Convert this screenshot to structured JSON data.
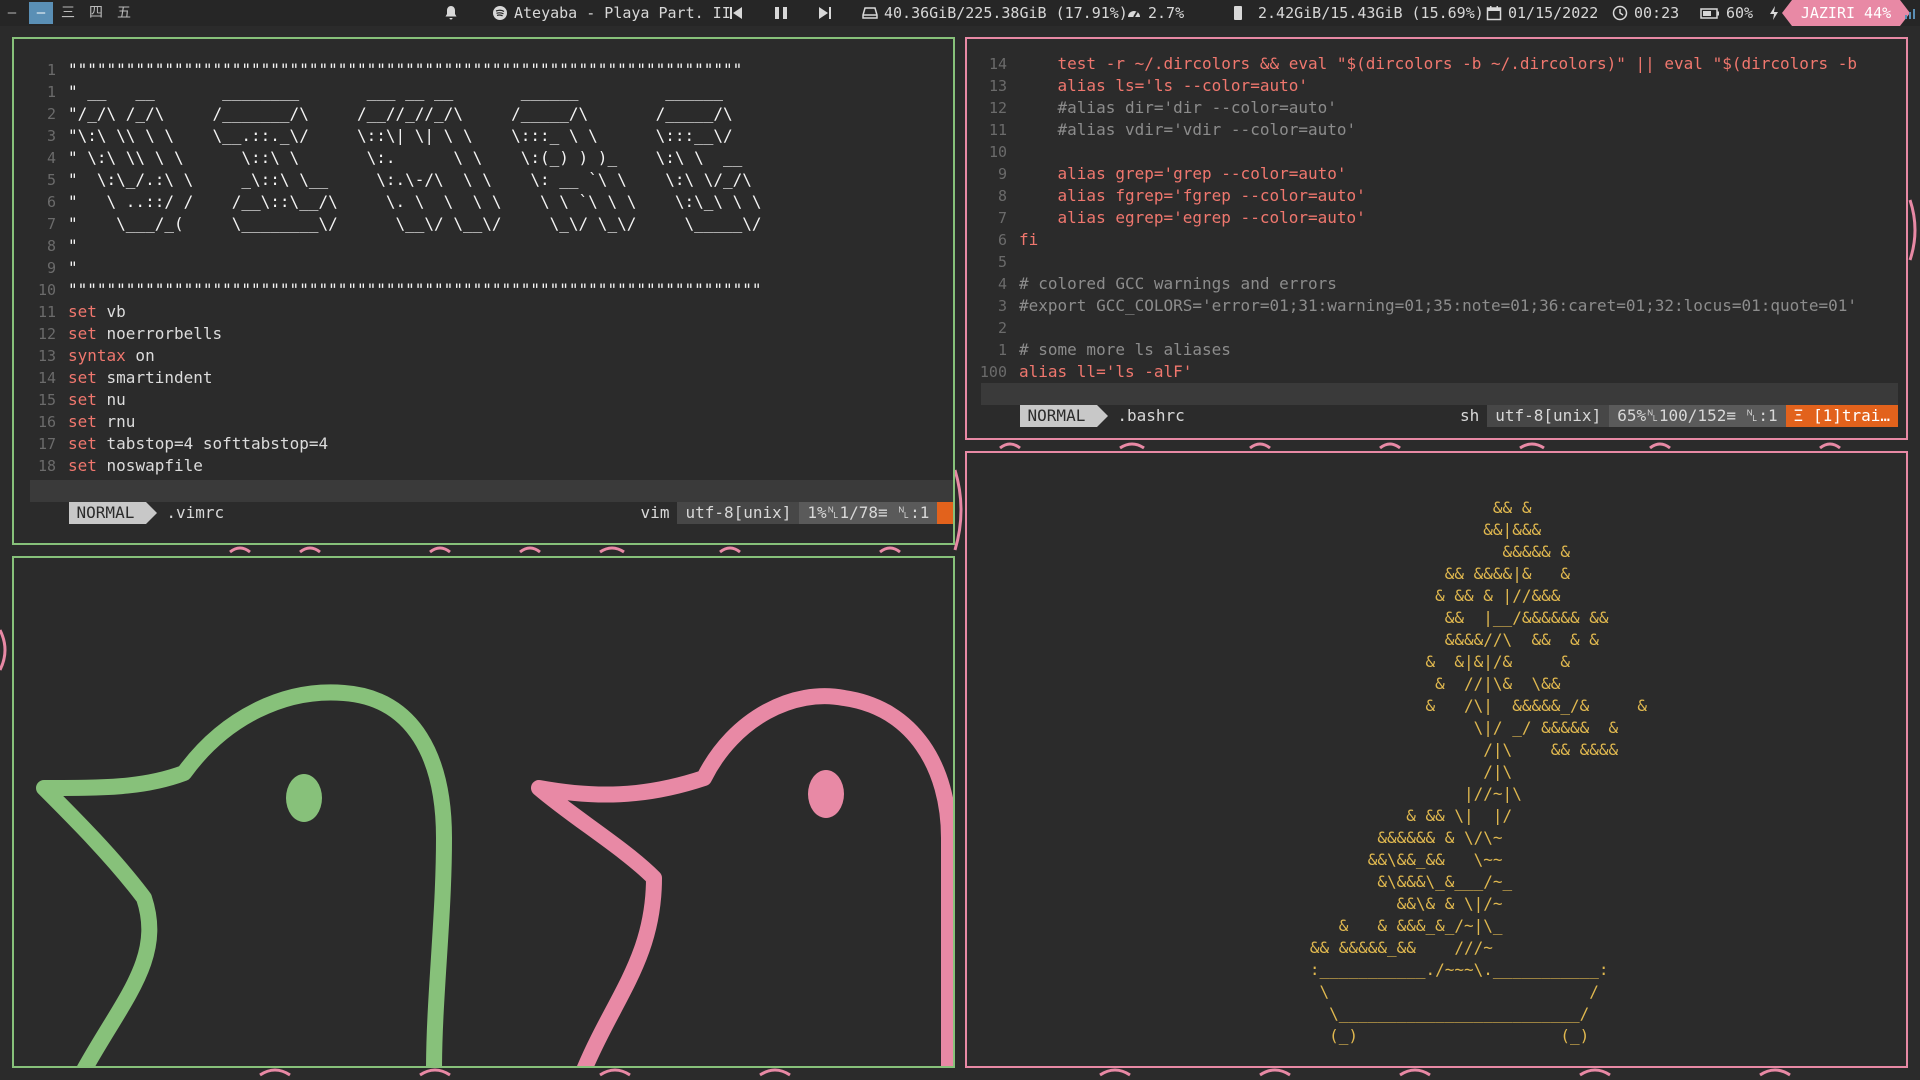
{
  "topbar": {
    "workspaces": [
      "—",
      "—",
      "三",
      "四",
      "五"
    ],
    "music": "Ateyaba - Playa Part. II",
    "disk": "40.36GiB/225.38GiB (17.91%)",
    "cpu": "2.7%",
    "memory": "2.42GiB/15.43GiB (15.69%)",
    "date": "01/15/2022",
    "time": "00:23",
    "battery": "60%",
    "tag": "JAZIRI 44%"
  },
  "vimrc": {
    "lines": [
      {
        "n": "1",
        "t": "\"\"\"\"\"\"\"\"\"\"\"\"\"\"\"\"\"\"\"\"\"\"\"\"\"\"\"\"\"\"\"\"\"\"\"\"\"\"\"\"\"\"\"\"\"\"\"\"\"\"\"\"\"\"\"\"\"\"\"\"\"\"\"\"\"\"\"\"\"\""
      },
      {
        "n": "1",
        "t": "\" __   __       ________       ___ __ __       ______         ______"
      },
      {
        "n": "2",
        "t": "\"/_/\\ /_/\\     /_______/\\     /__//_//_/\\     /_____/\\       /_____/\\"
      },
      {
        "n": "3",
        "t": "\"\\:\\ \\\\ \\ \\    \\__.::._\\/     \\::\\| \\| \\ \\    \\:::_ \\ \\      \\:::__\\/"
      },
      {
        "n": "4",
        "t": "\" \\:\\ \\\\ \\ \\      \\::\\ \\       \\:.      \\ \\    \\:(_) ) )_    \\:\\ \\  __"
      },
      {
        "n": "5",
        "t": "\"  \\:\\_/.:\\ \\     _\\::\\ \\__     \\:.\\-/\\  \\ \\    \\: __ `\\ \\    \\:\\ \\/_/\\"
      },
      {
        "n": "6",
        "t": "\"   \\ ..::/ /    /__\\::\\__/\\     \\. \\  \\  \\ \\    \\ \\ `\\ \\ \\    \\:\\_\\ \\ \\"
      },
      {
        "n": "7",
        "t": "\"    \\___/_(     \\________\\/      \\__\\/ \\__\\/     \\_\\/ \\_\\/     \\_____\\/"
      },
      {
        "n": "8",
        "t": "\""
      },
      {
        "n": "9",
        "t": "\""
      },
      {
        "n": "10",
        "t": "\"\"\"\"\"\"\"\"\"\"\"\"\"\"\"\"\"\"\"\"\"\"\"\"\"\"\"\"\"\"\"\"\"\"\"\"\"\"\"\"\"\"\"\"\"\"\"\"\"\"\"\"\"\"\"\"\"\"\"\"\"\"\"\"\"\"\"\"\"\"\"\""
      },
      {
        "n": "11",
        "k": "set",
        "t": " vb"
      },
      {
        "n": "12",
        "k": "set",
        "t": " noerrorbells"
      },
      {
        "n": "13",
        "k": "syntax",
        "t": " on"
      },
      {
        "n": "14",
        "k": "set",
        "t": " smartindent"
      },
      {
        "n": "15",
        "k": "set",
        "t": " nu"
      },
      {
        "n": "16",
        "k": "set",
        "t": " rnu"
      },
      {
        "n": "17",
        "k": "set",
        "t": " tabstop=4 softtabstop=4"
      },
      {
        "n": "18",
        "k": "set",
        "t": " noswapfile"
      }
    ],
    "status": {
      "mode": "NORMAL",
      "file": ".vimrc",
      "ft": "vim",
      "enc": "utf-8[unix]",
      "pos": "1%␤1/78≡ ␤:1"
    }
  },
  "bashrc": {
    "lines": [
      {
        "n": "14",
        "t": "    test -r ~/.dircolors && eval \"$(dircolors -b ~/.dircolors)\" || eval \"$(dircolors -b"
      },
      {
        "n": "13",
        "t": "    alias ls='ls --color=auto'"
      },
      {
        "n": "12",
        "t": "    #alias dir='dir --color=auto'"
      },
      {
        "n": "11",
        "t": "    #alias vdir='vdir --color=auto'"
      },
      {
        "n": "10",
        "t": ""
      },
      {
        "n": "9",
        "t": "    alias grep='grep --color=auto'"
      },
      {
        "n": "8",
        "t": "    alias fgrep='fgrep --color=auto'"
      },
      {
        "n": "7",
        "t": "    alias egrep='egrep --color=auto'"
      },
      {
        "n": "6",
        "t": "fi"
      },
      {
        "n": "5",
        "t": ""
      },
      {
        "n": "4",
        "t": "# colored GCC warnings and errors"
      },
      {
        "n": "3",
        "t": "#export GCC_COLORS='error=01;31:warning=01;35:note=01;36:caret=01;32:locus=01:quote=01'"
      },
      {
        "n": "2",
        "t": ""
      },
      {
        "n": "1",
        "t": "# some more ls aliases"
      },
      {
        "n": "100",
        "t": "alias ll='ls -alF'"
      }
    ],
    "status": {
      "mode": "NORMAL",
      "file": ".bashrc",
      "ft": "sh",
      "enc": "utf-8[unix]",
      "pos": "65%␤100/152≡ ␤:1",
      "warn": "Ξ [1]trai…"
    }
  },
  "bonsai": {
    "lines": [
      "                      && &",
      "                     &&|&&&",
      "                       &&&&& &",
      "                 && &&&&|&   &",
      "                & && & |//&&&",
      "                 &&  |__/&&&&&& &&",
      "                 &&&&//\\  &&  & &",
      "               &  &|&|/&     &",
      "                &  //|\\&  \\&&",
      "               &   /\\|  &&&&&_/&     &",
      "                    \\|/ _/ &&&&&  &",
      "                     /|\\    && &&&&",
      "                     /|\\",
      "                   |//~|\\",
      "             & && \\|  |/",
      "          &&&&&& & \\/\\~",
      "         &&\\&&_&&   \\~~",
      "          &\\&&&\\_&___/~_",
      "            &&\\& & \\|/~",
      "      &   & &&&_&_/~|\\_",
      "   && &&&&&_&&    ///~",
      "   :___________./~~~\\.___________:",
      "    \\                           /",
      "     \\_________________________/",
      "     (_)                     (_)"
    ]
  }
}
